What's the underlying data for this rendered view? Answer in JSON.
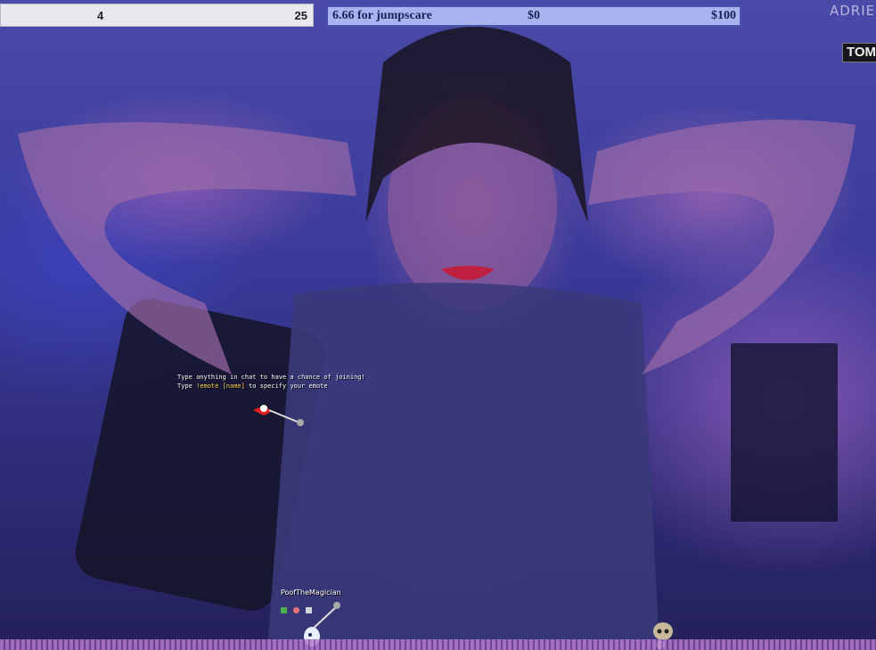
{
  "score_bar": {
    "left_value": "4",
    "right_value": "25"
  },
  "donation_bar": {
    "label": "6.66 for jumpscare",
    "current": "$0",
    "goal": "$100"
  },
  "corner": {
    "streamer_name": "ADRIE",
    "badge": "TOM"
  },
  "game": {
    "line1": "Type anything in chat to have a chance of joining!",
    "line2_prefix": "Type ",
    "line2_command": "!emote [name]",
    "line2_suffix": " to specify your emote",
    "player_name": "PoofTheMagician"
  },
  "colors": {
    "donation_bar_fill": "#a8b4f0",
    "donation_bar_border": "#4b54a8",
    "command_highlight": "#ffd44a",
    "equalizer": "#b77ad0"
  }
}
